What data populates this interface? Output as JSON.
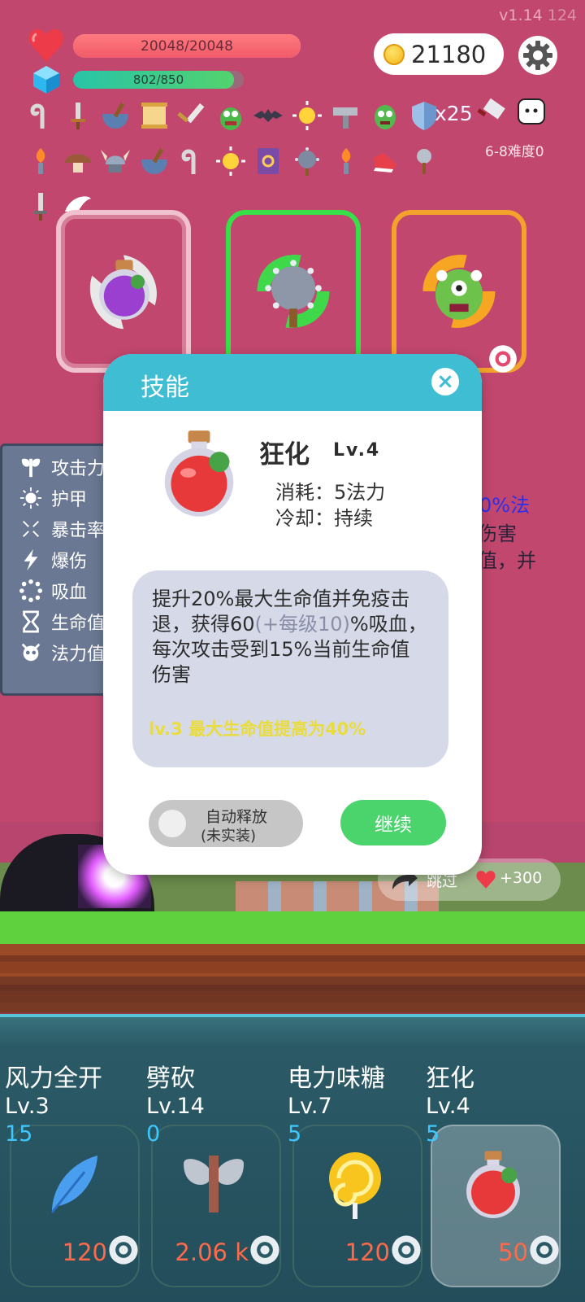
{
  "version": {
    "label": "v1.14",
    "fps": "124"
  },
  "player": {
    "hp_text": "20048/20048",
    "hp_fraction": 1.0,
    "mp_text": "802/850",
    "mp_fraction": 0.944
  },
  "currency": {
    "coins": "21180"
  },
  "inventory": {
    "shield_count": "x25",
    "difficulty": "6-8难度0"
  },
  "stats_panel": {
    "rows": [
      {
        "label": "攻击力",
        "icon": "axe-icon"
      },
      {
        "label": "护甲",
        "icon": "sun-icon"
      },
      {
        "label": "暴击率",
        "icon": "crosshair-icon"
      },
      {
        "label": "爆伤",
        "icon": "lightning-icon"
      },
      {
        "label": "吸血",
        "icon": "circle-dots-icon"
      },
      {
        "label": "生命值",
        "icon": "hourglass-icon"
      },
      {
        "label": "法力值",
        "icon": "skull-icon"
      }
    ]
  },
  "background_text": {
    "line1": "0%法",
    "line2": "伤害",
    "line3": "值，并"
  },
  "modal": {
    "title": "技能",
    "close_label": "×",
    "skill_name": "狂化",
    "skill_level": "Lv.4",
    "cost": "消耗：5法力",
    "cooldown": "冷却：持续",
    "description_part1": "提升20%最大生命值并免疫击退，获得60",
    "description_muted": "(+每级10)",
    "description_part2": "%吸血，每次攻击受到15%当前生命值伤害",
    "upgrade_note": "lv.3 最大生命值提高为40%",
    "auto_release_line1": "自动释放",
    "auto_release_line2": "(未实装)",
    "auto_release_on": false,
    "continue_label": "继续"
  },
  "scene": {
    "skip_label": "跳过",
    "skip_bonus": "+300"
  },
  "skill_bar": [
    {
      "name": "风力全开",
      "level": "Lv.3",
      "mana": "15",
      "price": "120",
      "icon": "feather-icon"
    },
    {
      "name": "劈砍",
      "level": "Lv.14",
      "mana": "0",
      "price": "2.06 k",
      "icon": "battle-axe-icon"
    },
    {
      "name": "电力味糖",
      "level": "Lv.7",
      "mana": "5",
      "price": "120",
      "icon": "lollipop-icon"
    },
    {
      "name": "狂化",
      "level": "Lv.4",
      "mana": "5",
      "price": "50",
      "icon": "red-potion-icon"
    }
  ],
  "colors": {
    "background": "#c2476e",
    "modal_header": "#3fbdd2",
    "continue_button": "#4bd36c",
    "mana_text": "#3ec7ff",
    "price_text": "#ff6a4a"
  }
}
